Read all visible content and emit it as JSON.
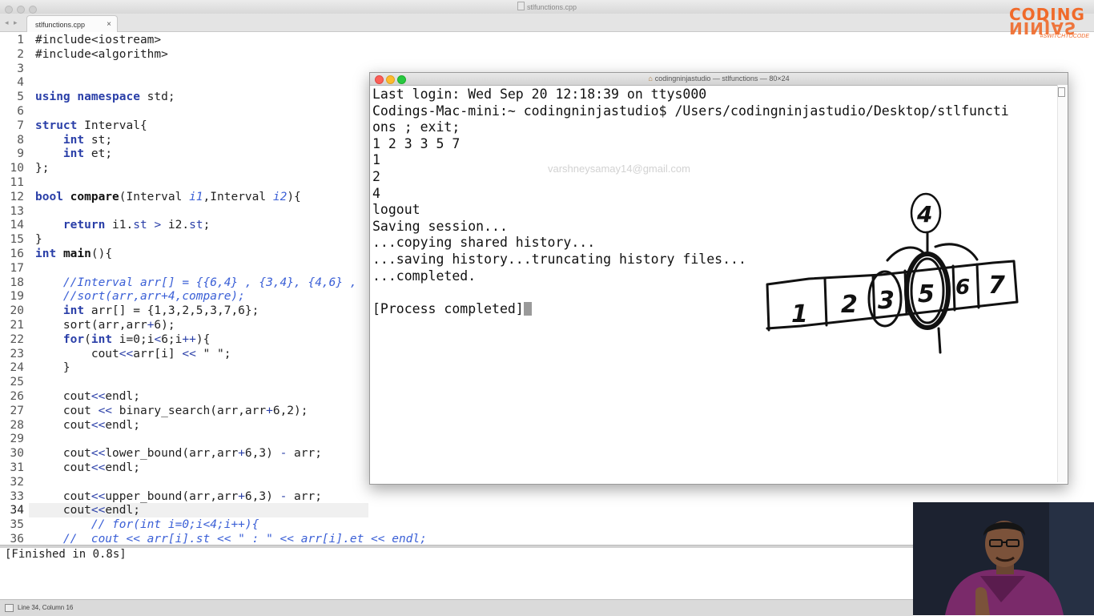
{
  "editor": {
    "window_title": "stlfunctions.cpp",
    "tab_label": "stlfunctions.cpp",
    "tab_close": "×",
    "nav_arrows": "◂ ▸",
    "line_numbers": [
      "1",
      "2",
      "3",
      "4",
      "5",
      "6",
      "7",
      "8",
      "9",
      "10",
      "11",
      "12",
      "13",
      "14",
      "15",
      "16",
      "17",
      "18",
      "19",
      "20",
      "21",
      "22",
      "23",
      "24",
      "25",
      "26",
      "27",
      "28",
      "29",
      "30",
      "31",
      "32",
      "33",
      "34",
      "35",
      "36"
    ],
    "active_line": "34",
    "code": [
      [
        {
          "t": "#include<iostream>",
          "c": ""
        }
      ],
      [
        {
          "t": "#include<algorithm>",
          "c": ""
        }
      ],
      [],
      [],
      [
        {
          "t": "using namespace",
          "c": "kw"
        },
        {
          "t": " std;",
          "c": ""
        }
      ],
      [],
      [
        {
          "t": "struct",
          "c": "kw"
        },
        {
          "t": " Interval{",
          "c": ""
        }
      ],
      [
        {
          "t": "    ",
          "c": ""
        },
        {
          "t": "int",
          "c": "kw"
        },
        {
          "t": " st;",
          "c": ""
        }
      ],
      [
        {
          "t": "    ",
          "c": ""
        },
        {
          "t": "int",
          "c": "kw"
        },
        {
          "t": " et;",
          "c": ""
        }
      ],
      [
        {
          "t": "};",
          "c": ""
        }
      ],
      [],
      [
        {
          "t": "bool",
          "c": "kw"
        },
        {
          "t": " ",
          "c": ""
        },
        {
          "t": "compare",
          "c": "fn"
        },
        {
          "t": "(Interval ",
          "c": ""
        },
        {
          "t": "i1",
          "c": "cm"
        },
        {
          "t": ",Interval ",
          "c": ""
        },
        {
          "t": "i2",
          "c": "cm"
        },
        {
          "t": "){",
          "c": ""
        }
      ],
      [],
      [
        {
          "t": "    ",
          "c": ""
        },
        {
          "t": "return",
          "c": "kw"
        },
        {
          "t": " i1.",
          "c": ""
        },
        {
          "t": "st",
          "c": "mb"
        },
        {
          "t": " ",
          "c": ""
        },
        {
          "t": ">",
          "c": "op"
        },
        {
          "t": " i2.",
          "c": ""
        },
        {
          "t": "st",
          "c": "mb"
        },
        {
          "t": ";",
          "c": ""
        }
      ],
      [
        {
          "t": "}",
          "c": ""
        }
      ],
      [
        {
          "t": "int",
          "c": "kw"
        },
        {
          "t": " ",
          "c": ""
        },
        {
          "t": "main",
          "c": "fn"
        },
        {
          "t": "(){",
          "c": ""
        }
      ],
      [],
      [
        {
          "t": "    ",
          "c": ""
        },
        {
          "t": "//Interval arr[] = {{6,4} , {3,4}, {4,6} ,",
          "c": "cm"
        }
      ],
      [
        {
          "t": "    ",
          "c": ""
        },
        {
          "t": "//sort(arr,arr+4,compare);",
          "c": "cm"
        }
      ],
      [
        {
          "t": "    ",
          "c": ""
        },
        {
          "t": "int",
          "c": "kw"
        },
        {
          "t": " arr[] = {1,3,2,5,3,7,6};",
          "c": ""
        }
      ],
      [
        {
          "t": "    sort(arr,arr",
          "c": ""
        },
        {
          "t": "+",
          "c": "op"
        },
        {
          "t": "6);",
          "c": ""
        }
      ],
      [
        {
          "t": "    ",
          "c": ""
        },
        {
          "t": "for",
          "c": "kw"
        },
        {
          "t": "(",
          "c": ""
        },
        {
          "t": "int",
          "c": "kw"
        },
        {
          "t": " i=0;i",
          "c": ""
        },
        {
          "t": "<",
          "c": "op"
        },
        {
          "t": "6;i",
          "c": ""
        },
        {
          "t": "++",
          "c": "op"
        },
        {
          "t": "){",
          "c": ""
        }
      ],
      [
        {
          "t": "        cout",
          "c": ""
        },
        {
          "t": "<<",
          "c": "op"
        },
        {
          "t": "arr[i] ",
          "c": ""
        },
        {
          "t": "<<",
          "c": "op"
        },
        {
          "t": " \" \";",
          "c": ""
        }
      ],
      [
        {
          "t": "    }",
          "c": ""
        }
      ],
      [],
      [
        {
          "t": "    cout",
          "c": ""
        },
        {
          "t": "<<",
          "c": "op"
        },
        {
          "t": "endl;",
          "c": ""
        }
      ],
      [
        {
          "t": "    cout ",
          "c": ""
        },
        {
          "t": "<<",
          "c": "op"
        },
        {
          "t": " binary_search(arr,arr",
          "c": ""
        },
        {
          "t": "+",
          "c": "op"
        },
        {
          "t": "6,2);",
          "c": ""
        }
      ],
      [
        {
          "t": "    cout",
          "c": ""
        },
        {
          "t": "<<",
          "c": "op"
        },
        {
          "t": "endl;",
          "c": ""
        }
      ],
      [],
      [
        {
          "t": "    cout",
          "c": ""
        },
        {
          "t": "<<",
          "c": "op"
        },
        {
          "t": "lower_bound(arr,arr",
          "c": ""
        },
        {
          "t": "+",
          "c": "op"
        },
        {
          "t": "6,3) ",
          "c": ""
        },
        {
          "t": "-",
          "c": "op"
        },
        {
          "t": " arr;",
          "c": ""
        }
      ],
      [
        {
          "t": "    cout",
          "c": ""
        },
        {
          "t": "<<",
          "c": "op"
        },
        {
          "t": "endl;",
          "c": ""
        }
      ],
      [],
      [
        {
          "t": "    cout",
          "c": ""
        },
        {
          "t": "<<",
          "c": "op"
        },
        {
          "t": "upper_bound(arr,arr",
          "c": ""
        },
        {
          "t": "+",
          "c": "op"
        },
        {
          "t": "6,3) ",
          "c": ""
        },
        {
          "t": "-",
          "c": "op"
        },
        {
          "t": " arr;",
          "c": ""
        }
      ],
      [
        {
          "t": "    cout",
          "c": ""
        },
        {
          "t": "<<",
          "c": "op"
        },
        {
          "t": "endl;",
          "c": ""
        }
      ],
      [
        {
          "t": "        ",
          "c": ""
        },
        {
          "t": "// for(int i=0;i<4;i++){",
          "c": "cm"
        }
      ],
      [
        {
          "t": "    ",
          "c": ""
        },
        {
          "t": "//  cout << arr[i].st << \" : \" << arr[i].et << endl;",
          "c": "cm"
        }
      ]
    ],
    "output_text": "[Finished in 0.8s]",
    "status_text": "Line 34, Column 16"
  },
  "logo": {
    "line1": "CODING",
    "line2": "NINJAS",
    "tagline": "#SWITCHTOCODE",
    "color": "#f06a2a"
  },
  "terminal": {
    "title": "codingninjastudio — stlfunctions — 80×24",
    "lines": [
      "Last login: Wed Sep 20 12:18:39 on ttys000",
      "Codings-Mac-mini:~ codingninjastudio$ /Users/codingninjastudio/Desktop/stlfuncti",
      "ons ; exit;",
      "1 2 3 3 5 7",
      "1",
      "2",
      "4",
      "logout",
      "Saving session...",
      "...copying shared history...",
      "...saving history...truncating history files...",
      "...completed.",
      "",
      "[Process completed]"
    ],
    "watermark": "varshneysamay14@gmail.com"
  },
  "drawing": {
    "box_labels": [
      "1",
      "2",
      "3",
      "5",
      "6",
      "7"
    ],
    "circled_label": "4",
    "ink_color": "#111111"
  },
  "colors": {
    "keyword": "#2a3fa8",
    "comment": "#3a5fd6",
    "traffic_red": "#fc5f57",
    "traffic_yellow": "#fdbb2d",
    "traffic_green": "#28c840"
  }
}
